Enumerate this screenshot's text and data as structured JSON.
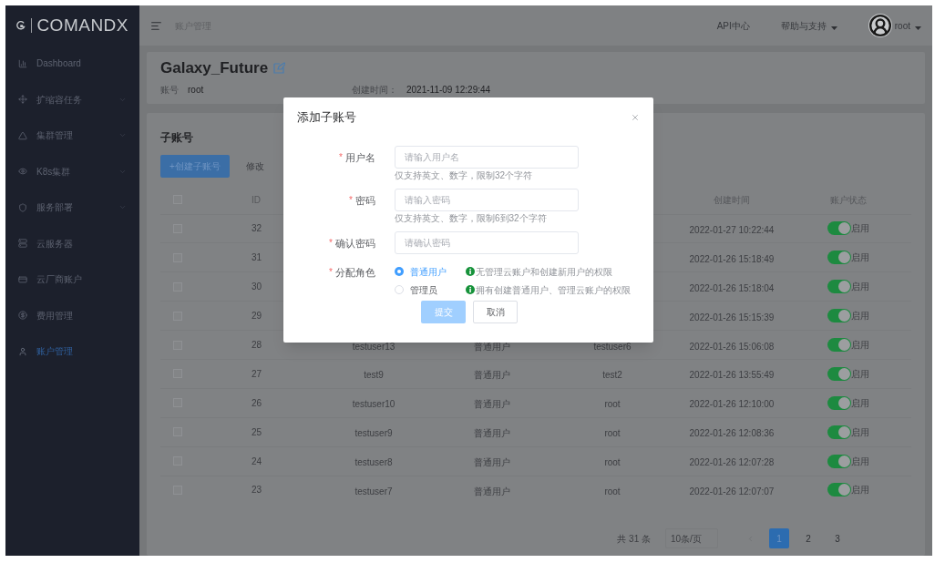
{
  "sidebar": {
    "logo": "COMANDX",
    "items": [
      {
        "label": "Dashboard",
        "expandable": false,
        "selected": false
      },
      {
        "label": "扩缩容任务",
        "expandable": true,
        "selected": false
      },
      {
        "label": "集群管理",
        "expandable": true,
        "selected": false
      },
      {
        "label": "K8s集群",
        "expandable": true,
        "selected": false
      },
      {
        "label": "服务部署",
        "expandable": true,
        "selected": false
      },
      {
        "label": "云服务器",
        "expandable": false,
        "selected": false
      },
      {
        "label": "云厂商账户",
        "expandable": false,
        "selected": false
      },
      {
        "label": "费用管理",
        "expandable": false,
        "selected": false
      },
      {
        "label": "账户管理",
        "expandable": false,
        "selected": true
      }
    ]
  },
  "topbar": {
    "breadcrumb": "账户管理",
    "links": [
      {
        "label": "API中心",
        "dropdown": false
      },
      {
        "label": "帮助与支持",
        "dropdown": true
      }
    ],
    "user": "root"
  },
  "account": {
    "name": "Galaxy_Future",
    "fields": [
      {
        "label": "账号",
        "value": "root"
      },
      {
        "label": "创建时间：",
        "value": "2021-11-09 12:29:44"
      }
    ]
  },
  "subaccounts": {
    "title": "子账号",
    "buttons": [
      {
        "label": "+创建子账号",
        "kind": "primary"
      },
      {
        "label": "修改",
        "kind": "text"
      }
    ],
    "columns": [
      "ID",
      "创建时间",
      "账户状态"
    ],
    "all_checked": false,
    "rows": [
      {
        "id": "32",
        "checked": false,
        "created": "2022-01-27 10:22:44",
        "on": true,
        "status": "启用"
      },
      {
        "id": "31",
        "checked": false,
        "created": "2022-01-26 15:18:49",
        "on": true,
        "status": "启用"
      },
      {
        "id": "30",
        "checked": false,
        "created": "2022-01-26 15:18:04",
        "on": true,
        "status": "启用"
      },
      {
        "id": "29",
        "checked": false,
        "created": "2022-01-26 15:15:39",
        "on": true,
        "status": "启用"
      },
      {
        "id": "28",
        "checked": false,
        "name": "testuser13",
        "role": "普通用户",
        "creator": "testuser6",
        "created": "2022-01-26 15:06:08",
        "on": true,
        "status": "启用"
      },
      {
        "id": "27",
        "checked": false,
        "name": "test9",
        "role": "普通用户",
        "creator": "test2",
        "created": "2022-01-26 13:55:49",
        "on": true,
        "status": "启用"
      },
      {
        "id": "26",
        "checked": false,
        "name": "testuser10",
        "role": "普通用户",
        "creator": "root",
        "created": "2022-01-26 12:10:00",
        "on": true,
        "status": "启用"
      },
      {
        "id": "25",
        "checked": false,
        "name": "testuser9",
        "role": "普通用户",
        "creator": "root",
        "created": "2022-01-26 12:08:36",
        "on": true,
        "status": "启用"
      },
      {
        "id": "24",
        "checked": false,
        "name": "testuser8",
        "role": "普通用户",
        "creator": "root",
        "created": "2022-01-26 12:07:28",
        "on": true,
        "status": "启用"
      },
      {
        "id": "23",
        "checked": false,
        "name": "testuser7",
        "role": "普通用户",
        "creator": "root",
        "created": "2022-01-26 12:07:07",
        "on": true,
        "status": "启用"
      }
    ],
    "pagination": {
      "total": "共 31 条",
      "page_size": "10条/页",
      "prev_disabled": true,
      "pages": [
        {
          "label": "1",
          "selected": true
        },
        {
          "label": "2",
          "selected": false
        },
        {
          "label": "3",
          "selected": false
        }
      ]
    }
  },
  "modal": {
    "title": "添加子账号",
    "fields": [
      {
        "required_mark": "*",
        "label": "用户名",
        "placeholder": "请输入用户名",
        "hint": "仅支持英文、数字，限制32个字符"
      },
      {
        "required_mark": "*",
        "label": "密码",
        "placeholder": "请输入密码",
        "hint": "仅支持英文、数字，限制6到32个字符"
      },
      {
        "required_mark": "*",
        "label": "确认密码",
        "placeholder": "请确认密码"
      }
    ],
    "role": {
      "required_mark": "*",
      "label": "分配角色",
      "options": [
        {
          "label": "普通用户",
          "selected": true,
          "note": "无管理云账户和创建新用户的权限"
        },
        {
          "label": "管理员",
          "selected": false,
          "note": "拥有创建普通用户、管理云账户的权限"
        }
      ]
    },
    "buttons": [
      {
        "label": "提交",
        "kind": "primary",
        "disabled": true
      },
      {
        "label": "取消",
        "kind": "default",
        "disabled": false
      }
    ]
  }
}
